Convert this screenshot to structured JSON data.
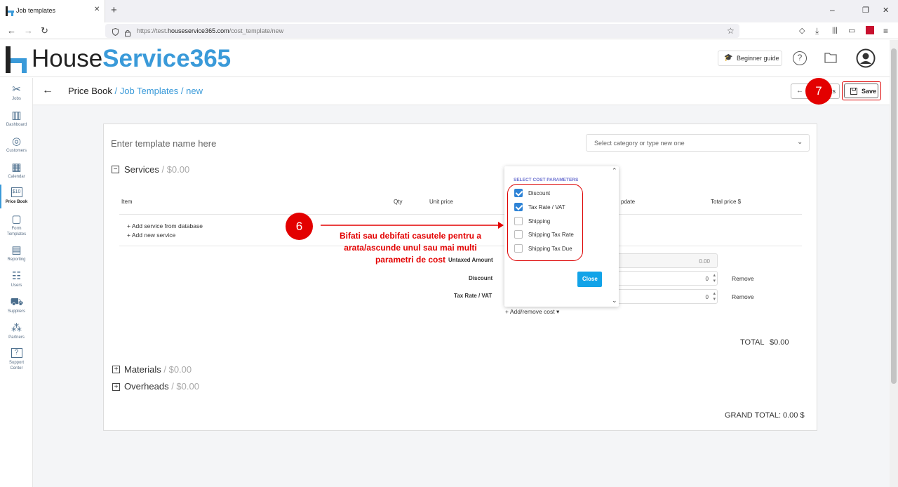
{
  "browser": {
    "tab_title": "Job templates",
    "new_tab": "+",
    "url_prefix": "https://test.",
    "url_domain": "houseservice365.com",
    "url_path": "/cost_template/new",
    "minimize": "–",
    "restore": "❐",
    "close": "✕"
  },
  "header": {
    "logo_house": "House",
    "logo_service": "Service365",
    "beginner_guide": "Beginner guide"
  },
  "sidebar": {
    "items": [
      {
        "label": "Jobs",
        "icon": "tools-icon"
      },
      {
        "label": "Dashboard",
        "icon": "chart-icon"
      },
      {
        "label": "Customers",
        "icon": "customers-icon"
      },
      {
        "label": "Calendar",
        "icon": "calendar-icon"
      },
      {
        "label": "Price Book",
        "icon": "price-book-icon"
      },
      {
        "label": "Form Templates",
        "icon": "form-icon"
      },
      {
        "label": "Reporting",
        "icon": "reporting-icon"
      },
      {
        "label": "Users",
        "icon": "users-icon"
      },
      {
        "label": "Suppliers",
        "icon": "truck-icon"
      },
      {
        "label": "Partners",
        "icon": "partners-icon"
      },
      {
        "label": "Support Center",
        "icon": "help-icon"
      }
    ]
  },
  "breadcrumb": {
    "root": "Price Book",
    "sep1": " / ",
    "section": "Job Templates",
    "sep2": " / ",
    "current": "new"
  },
  "actions": {
    "back_label": "←",
    "back_suffix": "ts",
    "save_label": "Save"
  },
  "form": {
    "name_placeholder": "Enter template name here",
    "category_placeholder": "Select category or type new one",
    "services_title": "Services",
    "services_total": " / $0.00",
    "columns": {
      "item": "Item",
      "qty": "Qty",
      "unit_price": "Unit price",
      "update": "pdate",
      "total": "Total price $"
    },
    "add_from_db": "+ Add service from database",
    "add_new": "+ Add new service",
    "untaxed_label": "Untaxed Amount",
    "untaxed_value": "0.00",
    "discount_label": "Discount",
    "discount_value": "0",
    "tax_label": "Tax Rate / VAT",
    "tax_value": "0",
    "remove": "Remove",
    "add_remove_cost": "+ Add/remove cost ▾",
    "total_label": "TOTAL",
    "total_value": "$0.00",
    "materials_title": "Materials",
    "materials_total": " / $0.00",
    "overheads_title": "Overheads",
    "overheads_total": " / $0.00",
    "grand_total_label": "GRAND TOTAL:",
    "grand_total_value": "0.00 $"
  },
  "popup": {
    "title": "SELECT COST PARAMETERS",
    "options": [
      {
        "label": "Discount",
        "checked": true
      },
      {
        "label": "Tax Rate / VAT",
        "checked": true
      },
      {
        "label": "Shipping",
        "checked": false
      },
      {
        "label": "Shipping Tax Rate",
        "checked": false
      },
      {
        "label": "Shipping Tax Due",
        "checked": false
      }
    ],
    "close_label": "Close"
  },
  "annotations": {
    "step6": "6",
    "step7": "7",
    "line1": "Bifati sau debifati casutele pentru a",
    "line2": "arata/ascunde unul sau mai multi",
    "line3": "parametri de cost"
  },
  "colors": {
    "accent_blue": "#3a9ad9",
    "annotation_red": "#e30000",
    "close_button": "#12a3e8"
  }
}
